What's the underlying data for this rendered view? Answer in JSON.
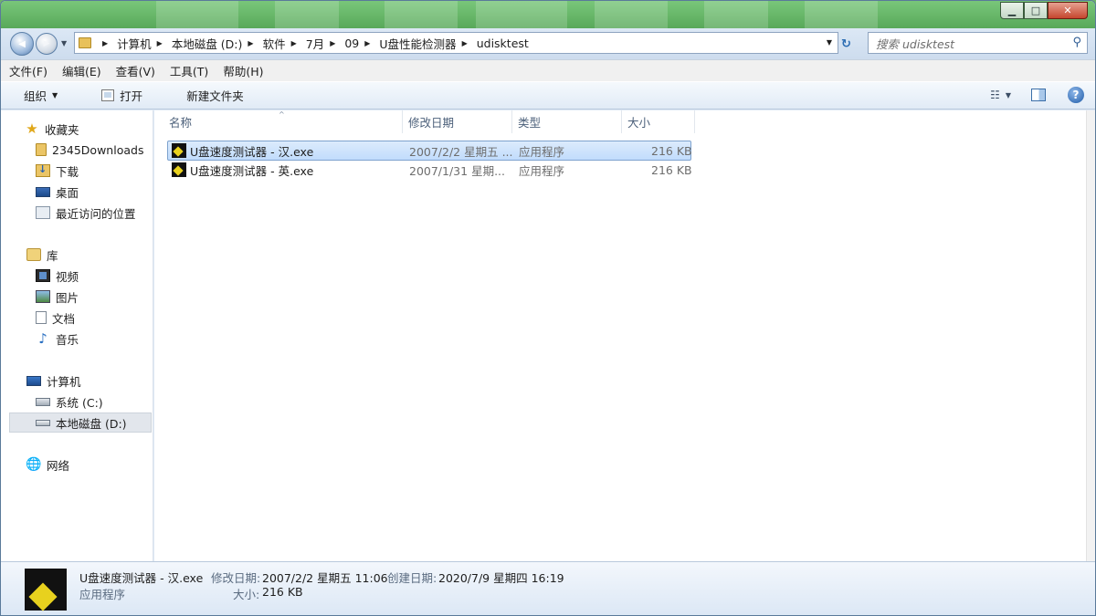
{
  "window": {
    "min_label": "▁",
    "max_label": "□",
    "close_label": "✕"
  },
  "address": {
    "back": "◀",
    "forward": "▶",
    "history_dropdown": "▼",
    "crumbs": [
      "计算机",
      "本地磁盘 (D:)",
      "软件",
      "7月",
      "09",
      "U盘性能检测器",
      "udisktest"
    ],
    "separator": "▶",
    "dropdown": "▼",
    "refresh": "↻"
  },
  "search": {
    "placeholder": "搜索 udisktest",
    "icon": "⚲"
  },
  "menubar": {
    "items": [
      "文件(F)",
      "编辑(E)",
      "查看(V)",
      "工具(T)",
      "帮助(H)"
    ]
  },
  "toolbar": {
    "organize_label": "组织",
    "organize_caret": "▼",
    "open_label": "打开",
    "new_folder_label": "新建文件夹",
    "view_icon": "☷",
    "view_caret": "▼",
    "help": "?"
  },
  "navpane": {
    "favorites": {
      "label": "收藏夹",
      "items": [
        "2345Downloads",
        "下载",
        "桌面",
        "最近访问的位置"
      ]
    },
    "libraries": {
      "label": "库",
      "items": [
        "视频",
        "图片",
        "文档",
        "音乐"
      ]
    },
    "computer": {
      "label": "计算机",
      "items": [
        "系统 (C:)",
        "本地磁盘 (D:)"
      ],
      "selected": "本地磁盘 (D:)"
    },
    "network": {
      "label": "网络"
    },
    "icons": {
      "star": "★",
      "music": "♪",
      "net": "🌐"
    }
  },
  "columns": {
    "name": "名称",
    "modified": "修改日期",
    "type": "类型",
    "size": "大小",
    "sort_arrow": "^"
  },
  "files": [
    {
      "name": "U盘速度测试器 - 汉.exe",
      "modified": "2007/2/2 星期五 ...",
      "type": "应用程序",
      "size": "216 KB",
      "selected": true
    },
    {
      "name": "U盘速度测试器 - 英.exe",
      "modified": "2007/1/31 星期...",
      "type": "应用程序",
      "size": "216 KB",
      "selected": false
    }
  ],
  "details": {
    "filename": "U盘速度测试器 - 汉.exe",
    "filetype": "应用程序",
    "modified_label": "修改日期:",
    "modified_value": "2007/2/2 星期五 11:06",
    "created_label": "创建日期:",
    "created_value": "2020/7/9 星期四 16:19",
    "size_label": "大小:",
    "size_value": "216 KB"
  },
  "colors": {
    "desktop_green": "#6fb36a",
    "selection": "#c1dcfc",
    "chrome": "#dfe9f5"
  }
}
